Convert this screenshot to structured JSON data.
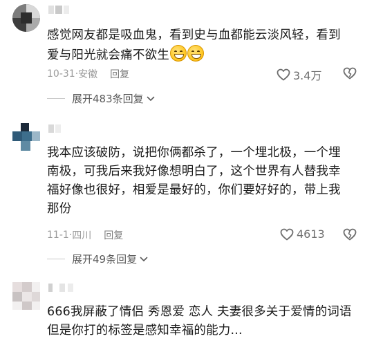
{
  "comments": [
    {
      "text_line1": "感觉网友都是吸血鬼，看到史与血都能云淡风轻，看到",
      "text_line2": "爱与阳光就会痛不欲生",
      "emoji": "grinning-sweat-emoji",
      "date": "10-31",
      "location": "安徽",
      "reply_label": "回复",
      "likes": "3.4万",
      "expand_label": "展开483条回复"
    },
    {
      "text": "我本应该破防，说把你俩都杀了，一个埋北极，一个埋\n南极，可我后来我好像想明白了，这个世界有人替我幸\n福好像也很好，相爱是最好的，你们要好好的，带上我\n那份",
      "date": "11-1",
      "location": "四川",
      "reply_label": "回复",
      "likes": "4613",
      "expand_label": "展开49条回复"
    },
    {
      "text": "666我屏蔽了情侣 秀恩爱 恋人 夫妻很多关于爱情的词语\n但是你打的标签是感知幸福的能力..."
    }
  ],
  "colors": {
    "text": "#1a1a1a",
    "meta": "#9a9a9a",
    "icon": "#6e6e6e"
  }
}
